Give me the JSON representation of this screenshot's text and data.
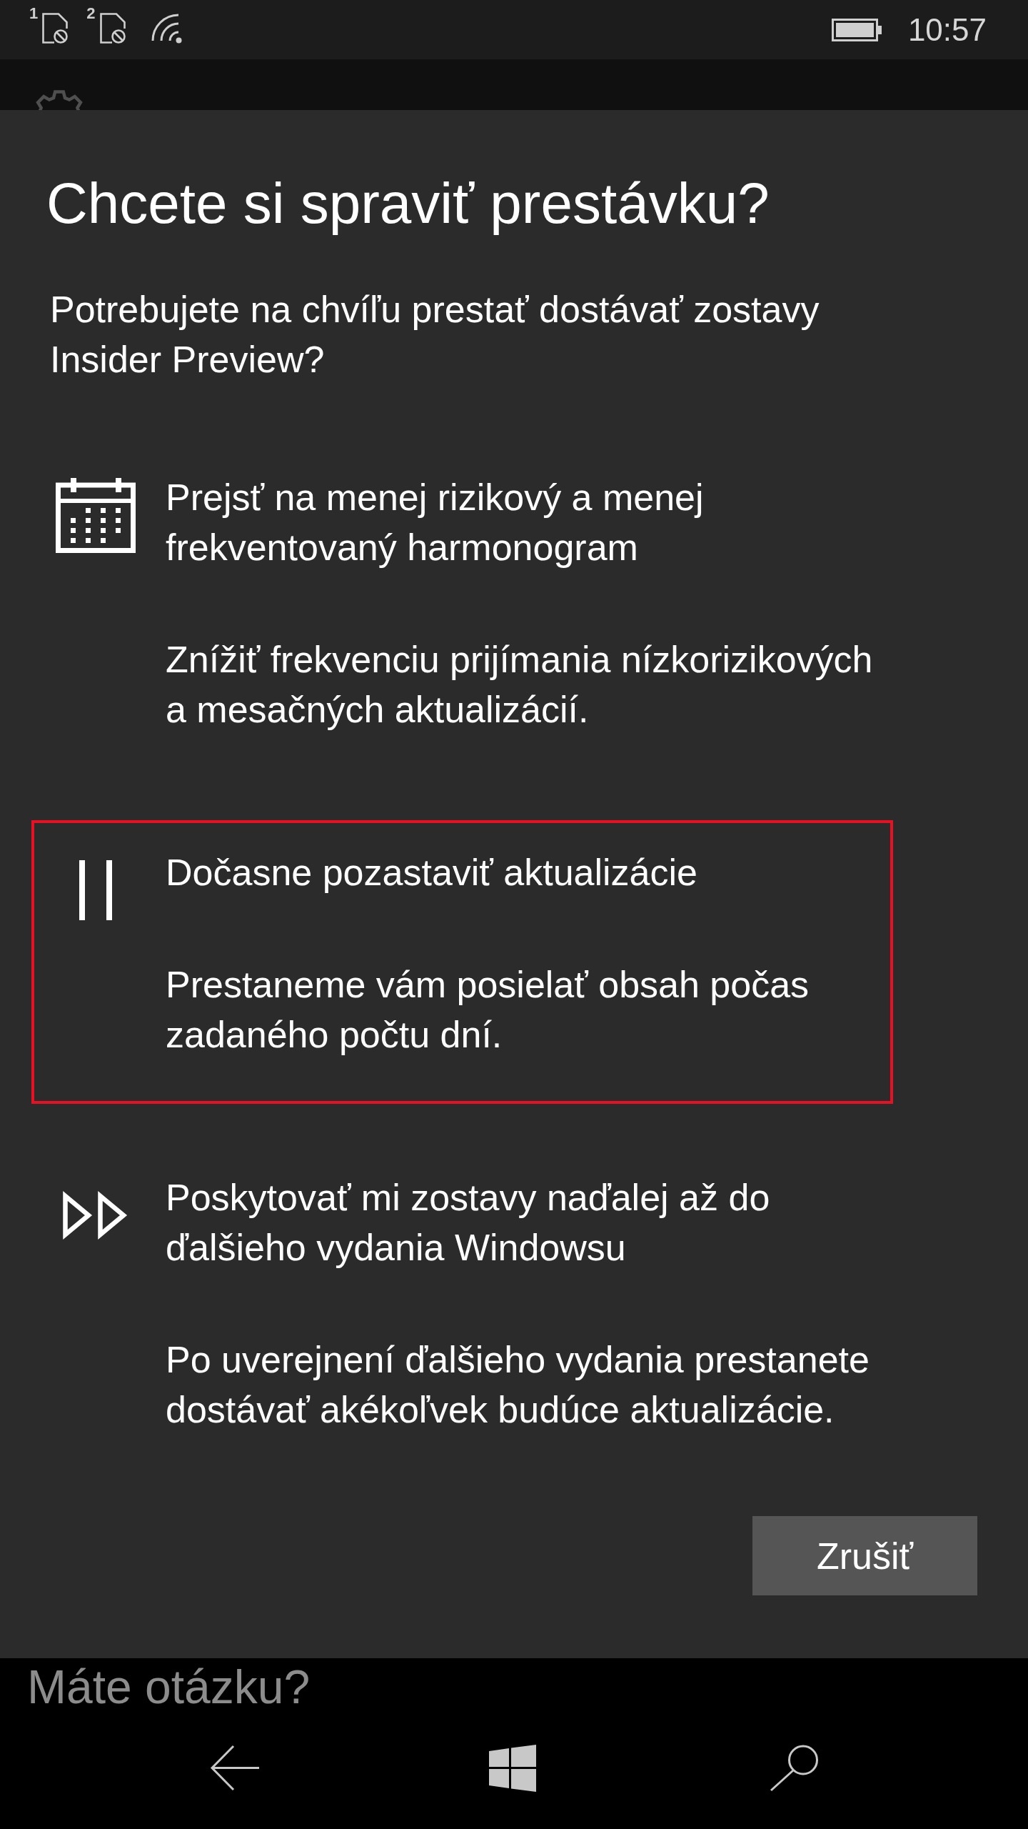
{
  "status_bar": {
    "sim_slots": [
      {
        "label": "1"
      },
      {
        "label": "2"
      }
    ],
    "time": "10:57"
  },
  "dialog": {
    "title": "Chcete si spraviť prestávku?",
    "message": "Potrebujete na chvíľu prestať dostávať zostavy Insider Preview?",
    "options": [
      {
        "kind": "calendar",
        "title": "Prejsť na menej rizikový a menej frekventovaný harmonogram",
        "description": "Znížiť frekvenciu prijímania nízkorizikových a mesačných aktualizácií.",
        "highlighted": false
      },
      {
        "kind": "pause",
        "title": "Dočasne pozastaviť aktualizácie",
        "description": "Prestaneme vám posielať obsah počas zadaného počtu dní.",
        "highlighted": true
      },
      {
        "kind": "fast-forward",
        "title": "Poskytovať mi zostavy naďalej až do ďalšieho vydania Windowsu",
        "description": "Po uverejnení ďalšieho vydania prestanete dostávať akékoľvek budúce aktualizácie.",
        "highlighted": false
      }
    ],
    "buttons": [
      {
        "label": "Zrušiť"
      }
    ]
  },
  "background_page": {
    "section_heading": "Máte otázku?"
  }
}
